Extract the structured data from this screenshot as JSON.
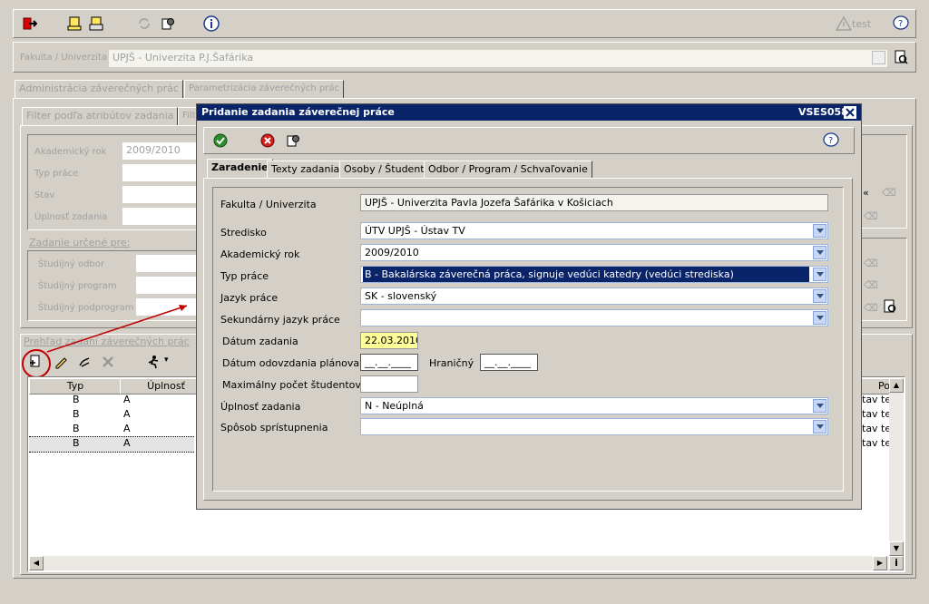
{
  "toolbar": {
    "test_label": "test"
  },
  "faculty_bar": {
    "label": "Fakulta / Univerzita",
    "value": "UPJŠ - Univerzita P.J.Šafárika"
  },
  "main_tabs": [
    {
      "label": "Administrácia záverečných prác"
    },
    {
      "label": "Parametrizácia záverečných prác"
    }
  ],
  "filter": {
    "tab_label": "Filter podľa atribútov zadania",
    "tab2_label": "Filt",
    "fields": {
      "akademicky_rok": {
        "label": "Akademický rok",
        "value": "2009/2010"
      },
      "typ_prace": {
        "label": "Typ práce",
        "value": ""
      },
      "stav": {
        "label": "Stav",
        "value": ""
      },
      "uplnost": {
        "label": "Úplnosť zadania",
        "value": ""
      }
    },
    "section_title": "Zadanie určené pre:",
    "section_fields": {
      "odbor": {
        "label": "Študijný odbor"
      },
      "program": {
        "label": "Študijný program"
      },
      "podprogram": {
        "label": "Študijný podprogram"
      }
    }
  },
  "overview": {
    "title": "Prehľad zadaní záverečných prác",
    "columns": [
      "Typ",
      "Úplnosť",
      "Po"
    ],
    "rows": [
      {
        "typ": "B",
        "uplnost": "A",
        "po": "tav tel"
      },
      {
        "typ": "B",
        "uplnost": "A",
        "po": "tav tel"
      },
      {
        "typ": "B",
        "uplnost": "A",
        "po": "tav tel"
      },
      {
        "typ": "B",
        "uplnost": "A",
        "po": "tav tel"
      }
    ]
  },
  "dialog": {
    "title": "Pridanie zadania záverečnej práce",
    "code": "VSES058",
    "tabs": [
      {
        "label": "Zaradenie"
      },
      {
        "label": "Texty zadania"
      },
      {
        "label": "Osoby / Študenti"
      },
      {
        "label": "Odbor / Program / Schvaľovanie"
      }
    ],
    "fields": {
      "fakulta": {
        "label": "Fakulta / Univerzita",
        "value": "UPJŠ - Univerzita Pavla Jozefa Šafárika  v Košiciach"
      },
      "stredisko": {
        "label": "Stredisko",
        "value": "ÚTV UPJŠ - Ústav TV"
      },
      "akademicky_rok": {
        "label": "Akademický rok",
        "value": "2009/2010"
      },
      "typ_prace": {
        "label": "Typ práce",
        "value": "B - Bakalárska záverečná práca, signuje vedúci katedry (vedúci strediska)"
      },
      "jazyk_prace": {
        "label": "Jazyk práce",
        "value": "SK - slovenský"
      },
      "sek_jazyk": {
        "label": "Sekundárny jazyk práce",
        "value": ""
      },
      "datum_zadania": {
        "label": "Dátum zadania",
        "value": "22.03.2010"
      },
      "datum_odovzdania": {
        "label": "Dátum odovzdania plánovaný",
        "value": "__.__.____"
      },
      "hranicny": {
        "label": "Hraničný",
        "value": "__.__.____"
      },
      "max_pocet": {
        "label": "Maximálny počet študentov",
        "value": ""
      },
      "uplnost": {
        "label": "Úplnosť zadania",
        "value": "N - Neúplná"
      },
      "sposob": {
        "label": "Spôsob sprístupnenia",
        "value": ""
      }
    }
  },
  "colors": {
    "dialog_title_bar": "#0a246a",
    "selected_row": "#0a246a",
    "highlight_field": "#ffff99",
    "annotation": "#c00000"
  }
}
